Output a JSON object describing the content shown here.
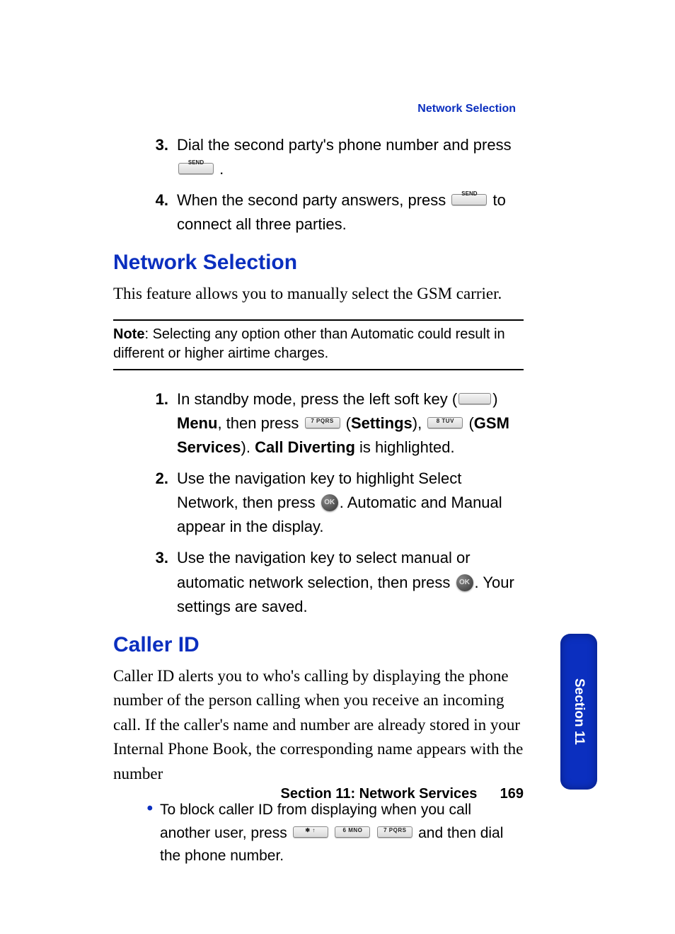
{
  "header_link": "Network Selection",
  "top_list": {
    "start": 3,
    "items": [
      {
        "num": "3.",
        "pre": "Dial the second party's phone number and press ",
        "key1": "SEND",
        "post": " ."
      },
      {
        "num": "4.",
        "pre": "When the second party answers, press ",
        "key1": "SEND",
        "post": " to connect all three parties."
      }
    ]
  },
  "network": {
    "title": "Network Selection",
    "intro": "This feature allows you to manually select the GSM carrier.",
    "note_label": "Note",
    "note_body": ": Selecting any option other than Automatic could result in different or higher airtime charges.",
    "steps": [
      {
        "num": "1.",
        "t1": "In standby mode, press the left soft key (",
        "key_blank": "",
        "t2": ") ",
        "b1": "Menu",
        "t3": ", then press ",
        "key7": "7 PQRS",
        "t4": " (",
        "b2": "Settings",
        "t5": "), ",
        "key8": "8 TUV",
        "t6": " (",
        "b3": "GSM Services",
        "t7": "). ",
        "b4": "Call Diverting",
        "t8": " is highlighted."
      },
      {
        "num": "2.",
        "t1": "Use the navigation key to highlight Select Network, then press ",
        "ok": "OK",
        "t2": ". Automatic and Manual appear in the display."
      },
      {
        "num": "3.",
        "t1": "Use the navigation key to select manual or automatic network selection, then press ",
        "ok": "OK",
        "t2": ". Your settings are saved."
      }
    ]
  },
  "caller_id": {
    "title": "Caller ID",
    "intro": "Caller ID alerts you to who's calling by displaying the phone number of the person calling when you receive an incoming call.  If the caller's name and number are already stored in your Internal Phone Book, the corresponding name appears with the number",
    "bullet": {
      "t1": "To block caller ID from displaying when you call another user, press ",
      "key_star": "✱ ↑",
      "key6": "6 MNO",
      "key7": "7 PQRS",
      "t2": " and then dial the phone number."
    }
  },
  "sidetab": "Section 11",
  "footer_text": "Section 11: Network Services",
  "page_number": "169"
}
